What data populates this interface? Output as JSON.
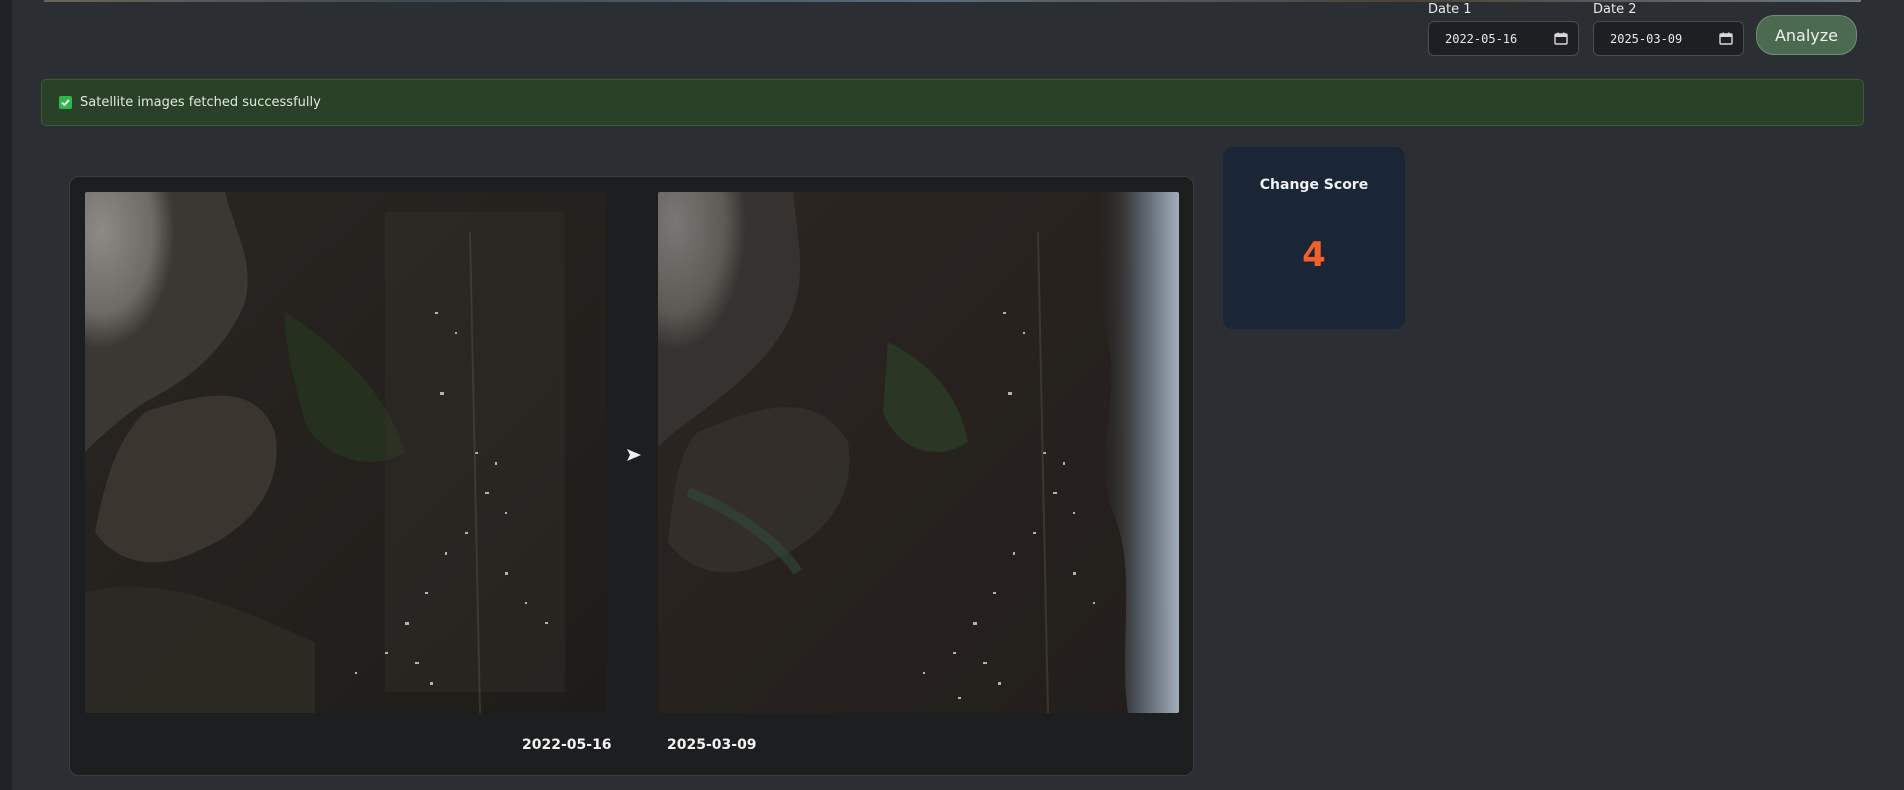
{
  "date1": {
    "label": "Date 1",
    "value": "2022-05-16"
  },
  "date2": {
    "label": "Date 2",
    "value": "2025-03-09"
  },
  "analyze": {
    "label": "Analyze",
    "color": "#4c6a4f"
  },
  "alert": {
    "message": "Satellite images fetched successfully",
    "icon": "check-icon",
    "color": "#2a4128"
  },
  "comparison": {
    "image1_date": "2022-05-16",
    "image2_date": "2025-03-09",
    "arrow_icon": "arrow-right-icon"
  },
  "score": {
    "title": "Change Score",
    "value": "4",
    "value_color": "#f2622a"
  }
}
